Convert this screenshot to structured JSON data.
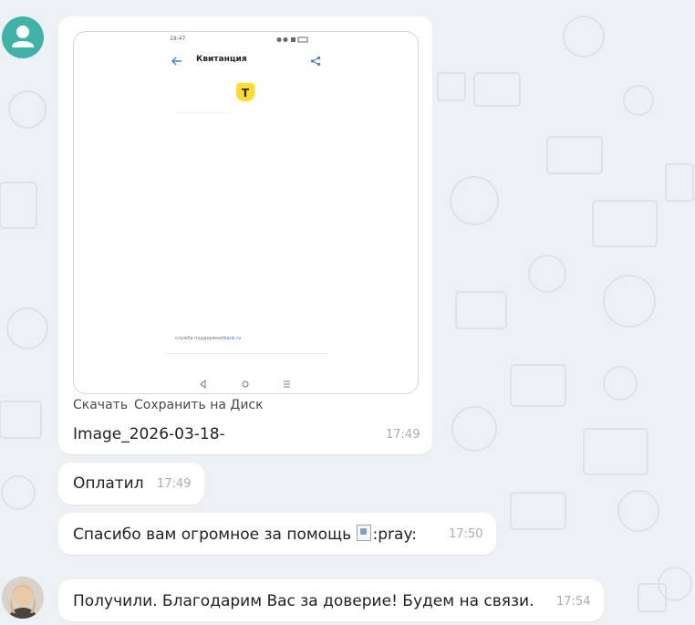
{
  "colors": {
    "accent": "#3fb3a8",
    "bubble": "#ffffff",
    "timestamp": "#a9aeb3",
    "tbank_yellow": "#ffdd2d",
    "link_blue": "#3f80d6"
  },
  "attachment": {
    "preview": {
      "status_time": "19:47",
      "screen_title": "Квитанция",
      "support_text": "служба поддержки",
      "support_link": "tbank.ru",
      "logo_letter": "T"
    },
    "actions": {
      "download": "Скачать",
      "save_to_disk": "Сохранить на Диск"
    },
    "filename": "Image_2026-03-18-",
    "time": "17:49"
  },
  "messages": [
    {
      "text": "Оплатил",
      "time": "17:49"
    },
    {
      "text": "Спасибо вам огромное за помощь",
      "emoji_alt": ":pray:",
      "time": "17:50"
    },
    {
      "text": "Получили. Благодарим Вас за доверие! Будем на связи.",
      "time": "17:54"
    }
  ]
}
